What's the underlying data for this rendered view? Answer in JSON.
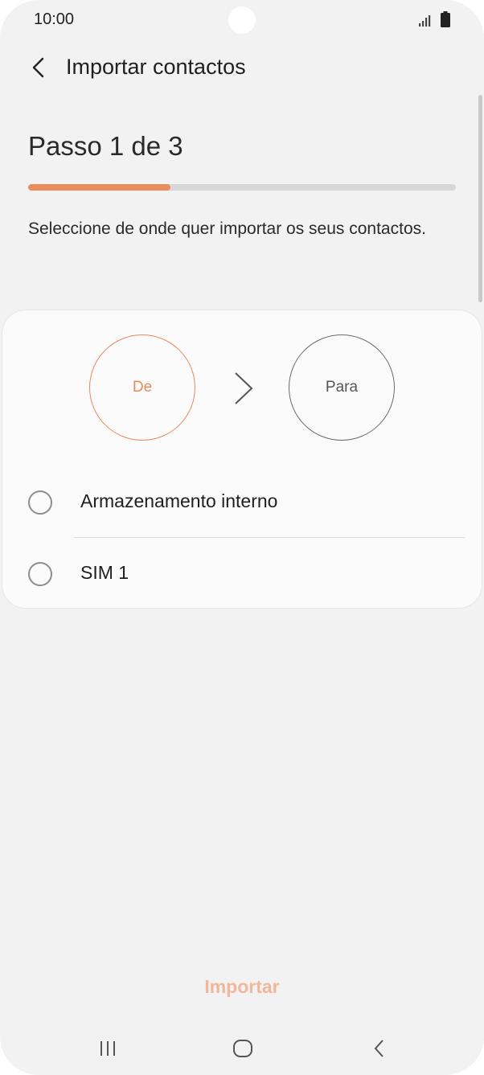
{
  "status_bar": {
    "time": "10:00",
    "icons": [
      "signal-icon",
      "battery-icon"
    ]
  },
  "app_bar": {
    "title": "Importar contactos",
    "back_icon": "back-arrow-icon"
  },
  "step": {
    "title": "Passo 1 de 3",
    "progress_fraction": 0.333,
    "instruction": "Seleccione de onde quer importar os seus contactos."
  },
  "flow": {
    "from_label": "De",
    "to_label": "Para",
    "arrow_icon": "chevron-right-icon"
  },
  "options": [
    {
      "label": "Armazenamento interno",
      "selected": false
    },
    {
      "label": "SIM 1",
      "selected": false
    }
  ],
  "actions": {
    "import_label": "Importar"
  },
  "nav_bar": {
    "icons": [
      "recent-apps-icon",
      "home-icon",
      "back-icon"
    ]
  },
  "colors": {
    "accent": "#eb8c5c",
    "accent_disabled": "#f0b79a",
    "background": "#f2f2f2",
    "card": "#fbfbfb"
  }
}
